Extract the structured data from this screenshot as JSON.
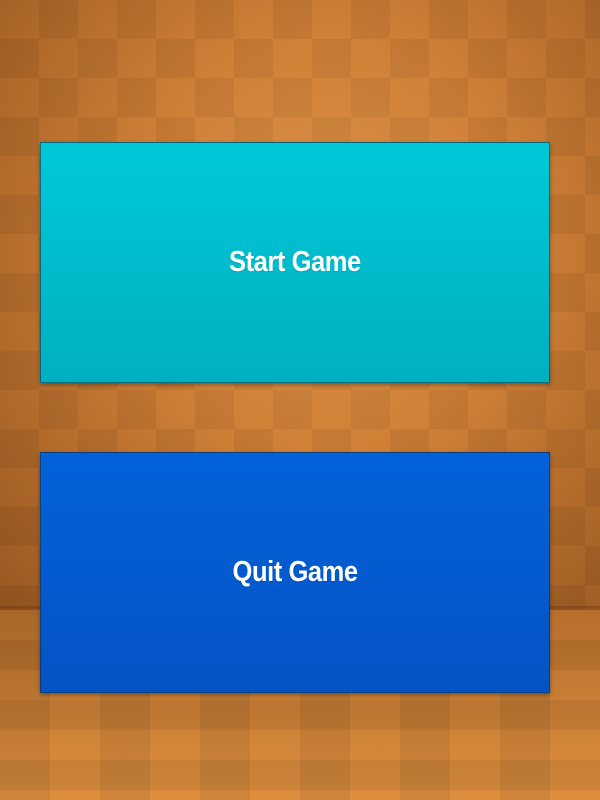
{
  "menu": {
    "start_label": "Start Game",
    "quit_label": "Quit Game"
  },
  "colors": {
    "start_button": "#00bccc",
    "quit_button": "#045bd0",
    "background": "#c97b33",
    "label_text": "#ffffff"
  }
}
